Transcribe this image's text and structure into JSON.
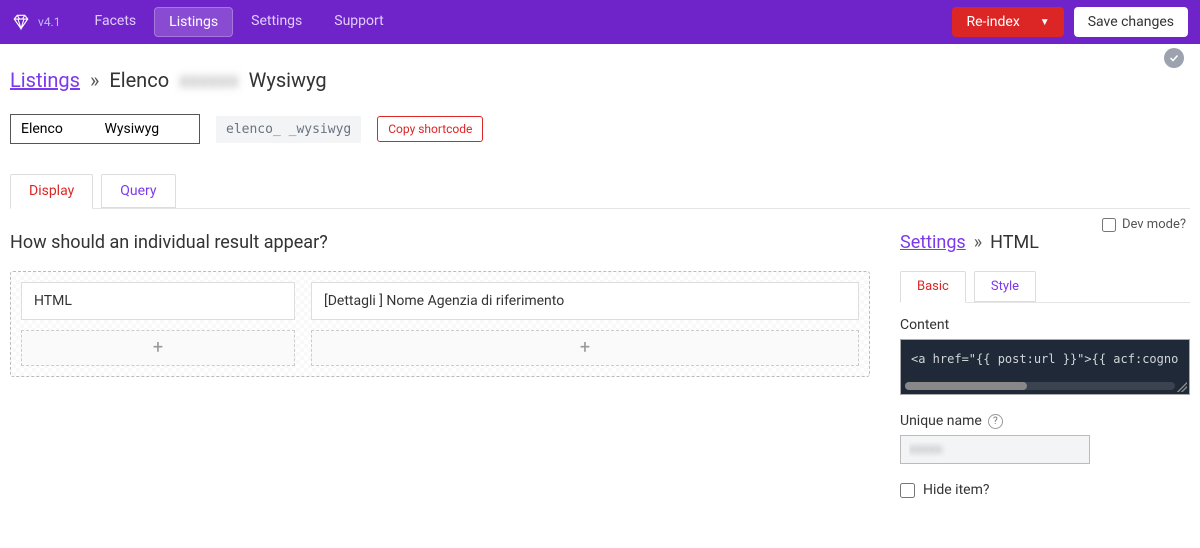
{
  "topbar": {
    "version": "v4.1",
    "nav": {
      "facets": "Facets",
      "listings": "Listings",
      "settings": "Settings",
      "support": "Support"
    },
    "reindex": "Re-index",
    "save": "Save changes"
  },
  "breadcrumb": {
    "root": "Listings",
    "sep": "»",
    "mid": "Elenco",
    "tail": "Wysiwyg"
  },
  "title_input": "Elenco            Wysiwyg",
  "slug": "elenco_            _wysiwyg",
  "copy_shortcode": "Copy shortcode",
  "tabs": {
    "display": "Display",
    "query": "Query"
  },
  "dev_mode": "Dev mode?",
  "left_heading": "How should an individual result appear?",
  "builder": {
    "col1_item": "HTML",
    "col2_item": "[Dettagli            ] Nome Agenzia di riferimento"
  },
  "right": {
    "bc_root": "Settings",
    "bc_leaf": "HTML",
    "tabs": {
      "basic": "Basic",
      "style": "Style"
    },
    "content_label": "Content",
    "code": "<a href=\"{{ post:url }}\">{{ acf:cogno",
    "uname_label": "Unique name",
    "uname_value": "xxxxx",
    "hide_label": "Hide item?"
  }
}
